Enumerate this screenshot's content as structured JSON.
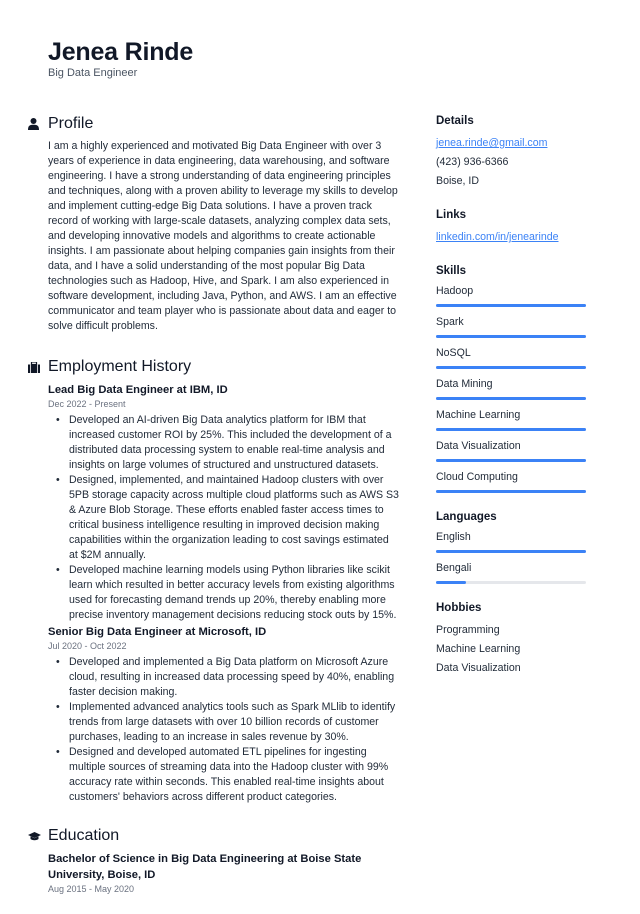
{
  "header": {
    "name": "Jenea Rinde",
    "role": "Big Data Engineer"
  },
  "colors": {
    "accent": "#3b82f6",
    "text": "#1f2937",
    "muted": "#6b7280",
    "track": "#e5e7eb"
  },
  "profile": {
    "title": "Profile",
    "icon": "user-icon",
    "text": "I am a highly experienced and motivated Big Data Engineer with over 3 years of experience in data engineering, data warehousing, and software engineering. I have a strong understanding of data engineering principles and techniques, along with a proven ability to leverage my skills to develop and implement cutting-edge Big Data solutions. I have a proven track record of working with large-scale datasets, analyzing complex data sets, and developing innovative models and algorithms to create actionable insights. I am passionate about helping companies gain insights from their data, and I have a solid understanding of the most popular Big Data technologies such as Hadoop, Hive, and Spark. I am also experienced in software development, including Java, Python, and AWS. I am an effective communicator and team player who is passionate about data and eager to solve difficult problems."
  },
  "employment": {
    "title": "Employment History",
    "icon": "briefcase-icon",
    "jobs": [
      {
        "title": "Lead Big Data Engineer at IBM, ID",
        "dates": "Dec 2022 - Present",
        "bullets": [
          "Developed an AI-driven Big Data analytics platform for IBM that increased customer ROI by 25%. This included the development of a distributed data processing system to enable real-time analysis and insights on large volumes of structured and unstructured datasets.",
          "Designed, implemented, and maintained Hadoop clusters with over 5PB storage capacity across multiple cloud platforms such as AWS S3 & Azure Blob Storage. These efforts enabled faster access times to critical business intelligence resulting in improved decision making capabilities within the organization leading to cost savings estimated at $2M annually.",
          "Developed machine learning models using Python libraries like scikit learn which resulted in better accuracy levels from existing algorithms used for forecasting demand trends up 20%, thereby enabling more precise inventory management decisions reducing stock outs by 15%."
        ]
      },
      {
        "title": "Senior Big Data Engineer at Microsoft, ID",
        "dates": "Jul 2020 - Oct 2022",
        "bullets": [
          "Developed and implemented a Big Data platform on Microsoft Azure cloud, resulting in increased data processing speed by 40%, enabling faster decision making.",
          "Implemented advanced analytics tools such as Spark MLlib to identify trends from large datasets with over 10 billion records of customer purchases, leading to an increase in sales revenue by 30%.",
          "Designed and developed automated ETL pipelines for ingesting multiple sources of streaming data into the Hadoop cluster with 99% accuracy rate within seconds. This enabled real-time insights about customers' behaviors across different product categories."
        ]
      }
    ]
  },
  "education": {
    "title": "Education",
    "icon": "graduation-cap-icon",
    "items": [
      {
        "title": "Bachelor of Science in Big Data Engineering at Boise State University, Boise, ID",
        "dates": "Aug 2015 - May 2020"
      }
    ]
  },
  "details": {
    "title": "Details",
    "email": "jenea.rinde@gmail.com",
    "phone": "(423) 936-6366",
    "location": "Boise, ID"
  },
  "links": {
    "title": "Links",
    "items": [
      {
        "label": "linkedin.com/in/jenearinde"
      }
    ]
  },
  "skills": {
    "title": "Skills",
    "items": [
      {
        "label": "Hadoop",
        "level_percent": 100
      },
      {
        "label": "Spark",
        "level_percent": 100
      },
      {
        "label": "NoSQL",
        "level_percent": 100
      },
      {
        "label": "Data Mining",
        "level_percent": 100
      },
      {
        "label": "Machine Learning",
        "level_percent": 100
      },
      {
        "label": "Data Visualization",
        "level_percent": 100
      },
      {
        "label": "Cloud Computing",
        "level_percent": 100
      }
    ]
  },
  "languages": {
    "title": "Languages",
    "items": [
      {
        "label": "English",
        "level_percent": 100
      },
      {
        "label": "Bengali",
        "level_percent": 20
      }
    ]
  },
  "hobbies": {
    "title": "Hobbies",
    "items": [
      "Programming",
      "Machine Learning",
      "Data Visualization"
    ]
  }
}
